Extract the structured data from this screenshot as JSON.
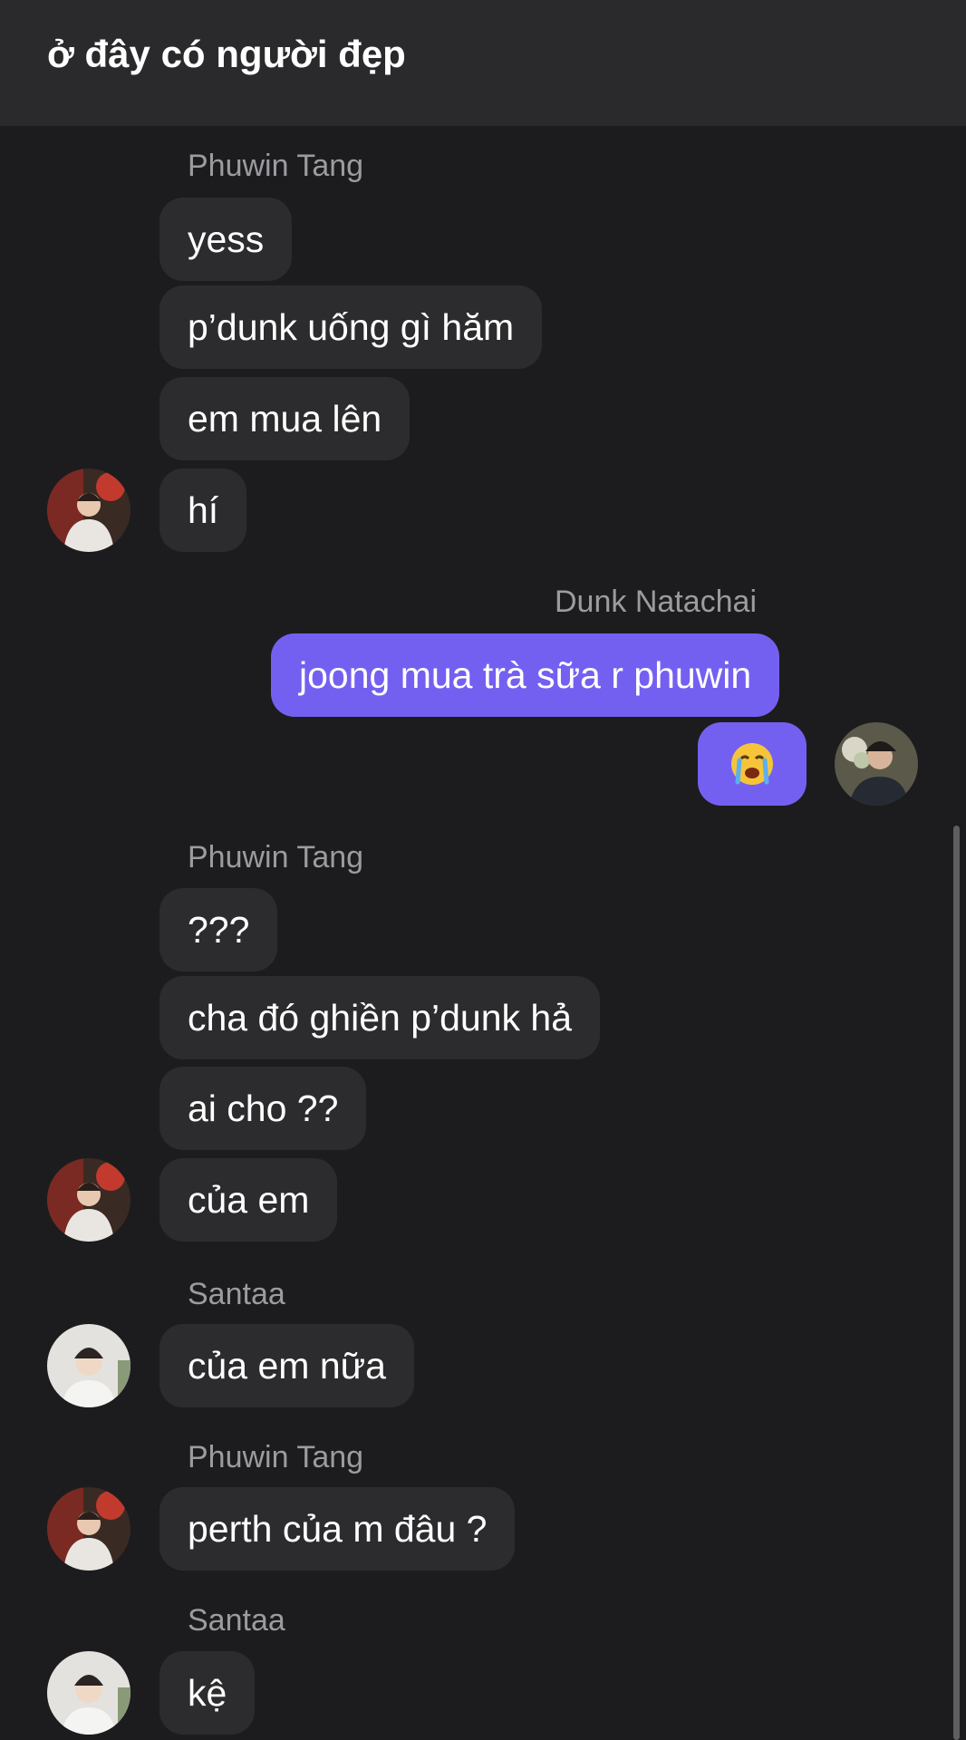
{
  "header": {
    "title": "ở đây có người đẹp"
  },
  "senders": {
    "phuwin": "Phuwin Tang",
    "dunk": "Dunk Natachai",
    "santaa": "Santaa"
  },
  "messages": {
    "m1": "yess",
    "m2": "p’dunk uống gì hăm",
    "m3": "em mua lên",
    "m4": "hí",
    "m5": "joong mua trà sữa r phuwin",
    "m7": "???",
    "m8": "cha đó ghiền p’dunk hả",
    "m9": "ai cho ??",
    "m10": "của em",
    "m11": "của em nữa",
    "m12": "perth của m đâu ?",
    "m13": "kệ"
  },
  "icons": {
    "crying_emoji": "loudly-crying-face-icon"
  },
  "colors": {
    "outgoing_bubble": "#7460f0",
    "incoming_bubble": "#2c2c2e",
    "background": "#1c1c1e"
  }
}
